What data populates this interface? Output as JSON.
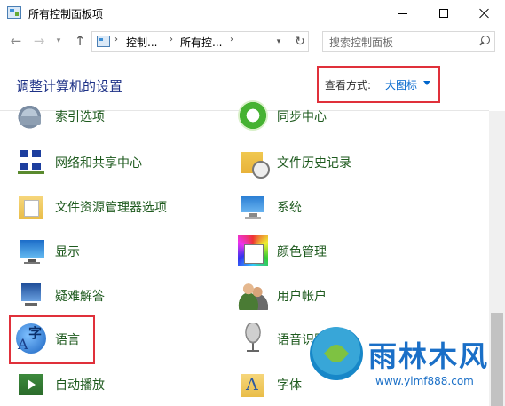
{
  "window": {
    "title": "所有控制面板项"
  },
  "nav": {
    "breadcrumb": [
      "控制...",
      "所有控..."
    ],
    "search_placeholder": "搜索控制面板"
  },
  "header": {
    "title": "调整计算机的设置",
    "view_by_label": "查看方式:",
    "view_by_value": "大图标"
  },
  "items": [
    {
      "label": "索引选项",
      "icon": "indexing-options-icon"
    },
    {
      "label": "同步中心",
      "icon": "sync-center-icon"
    },
    {
      "label": "网络和共享中心",
      "icon": "network-sharing-center-icon"
    },
    {
      "label": "文件历史记录",
      "icon": "file-history-icon"
    },
    {
      "label": "文件资源管理器选项",
      "icon": "file-explorer-options-icon"
    },
    {
      "label": "系统",
      "icon": "system-icon"
    },
    {
      "label": "显示",
      "icon": "display-icon"
    },
    {
      "label": "颜色管理",
      "icon": "color-management-icon"
    },
    {
      "label": "疑难解答",
      "icon": "troubleshooting-icon"
    },
    {
      "label": "用户帐户",
      "icon": "user-accounts-icon"
    },
    {
      "label": "语言",
      "icon": "language-icon"
    },
    {
      "label": "语音识别",
      "icon": "speech-recognition-icon"
    },
    {
      "label": "自动播放",
      "icon": "autoplay-icon"
    },
    {
      "label": "字体",
      "icon": "fonts-icon"
    }
  ],
  "watermark": {
    "name": "雨林木风",
    "url": "www.ylmf888.com"
  },
  "colors": {
    "highlight_border": "#e0303a",
    "link_blue": "#0066cc",
    "heading_blue": "#1e3287",
    "item_text_green": "#1e5a1e"
  }
}
